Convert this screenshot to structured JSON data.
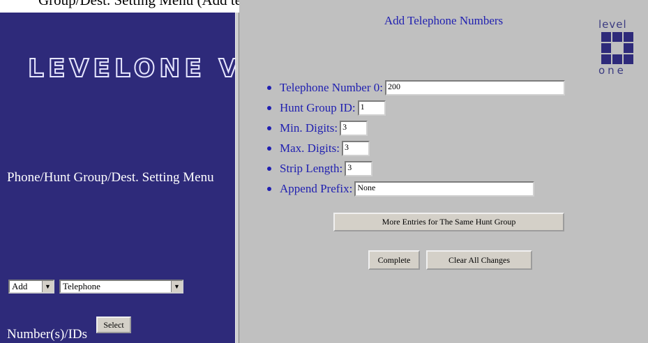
{
  "caption": "Group/Dest. Setting Menu (Add telephone from Main Menu",
  "left_panel": {
    "brand": "LEVELONE VOIP",
    "menu_title": "Phone/Hunt Group/Dest. Setting Menu",
    "action_select": "Add",
    "type_select": "Telephone",
    "numbers_label": "Number(s)/IDs",
    "select_button": "Select"
  },
  "form": {
    "heading": "Add Telephone Numbers",
    "logo_top": "level",
    "logo_bottom": "one",
    "fields": [
      {
        "label": "Telephone Number 0:",
        "value": "200"
      },
      {
        "label": "Hunt Group ID:",
        "value": "1"
      },
      {
        "label": "Min. Digits:",
        "value": "3"
      },
      {
        "label": "Max. Digits:",
        "value": "3"
      },
      {
        "label": "Strip Length:",
        "value": "3"
      },
      {
        "label": "Append Prefix:",
        "value": "None"
      }
    ],
    "more_entries_button": "More Entries for The Same Hunt Group",
    "complete_button": "Complete",
    "clear_button": "Clear All Changes"
  },
  "colors": {
    "left_bg": "#2e2a7a",
    "right_bg": "#c0c0c0",
    "label_blue": "#2020b0"
  }
}
